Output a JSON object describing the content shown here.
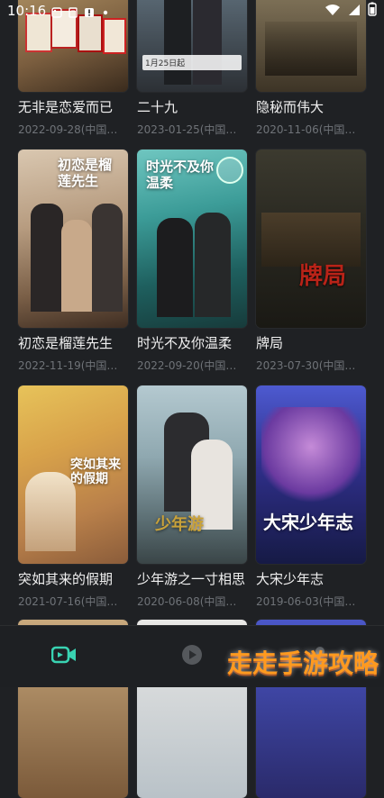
{
  "status_bar": {
    "time": "10:16"
  },
  "items": [
    {
      "title": "无非是恋爱而已",
      "meta": "2022-09-28(中国大陆...",
      "poster_text": ""
    },
    {
      "title": "二十九",
      "meta": "2023-01-25(中国大陆...",
      "poster_text": "1月25日起"
    },
    {
      "title": "隐秘而伟大",
      "meta": "2020-11-06(中国大陆...",
      "poster_text": ""
    },
    {
      "title": "初恋是榴莲先生",
      "meta": "2022-11-19(中国大陆...",
      "poster_text": "初恋是榴莲先生"
    },
    {
      "title": "时光不及你温柔",
      "meta": "2022-09-20(中国大陆...",
      "poster_text": "时光不及你温柔"
    },
    {
      "title": "牌局",
      "meta": "2023-07-30(中国大陆...",
      "poster_text": "牌局"
    },
    {
      "title": "突如其来的假期",
      "meta": "2021-07-16(中国大陆...",
      "poster_text": "突如其来的假期"
    },
    {
      "title": "少年游之一寸相思",
      "meta": "2020-06-08(中国大陆...",
      "poster_text": "少年游"
    },
    {
      "title": "大宋少年志",
      "meta": "2019-06-03(中国大陆...",
      "poster_text": "大宋少年志"
    }
  ],
  "bottom_nav": [
    {
      "name": "video-camera-icon"
    },
    {
      "name": "play-circle-icon"
    },
    {
      "name": "person-icon"
    }
  ],
  "watermark": "走走手游攻略"
}
